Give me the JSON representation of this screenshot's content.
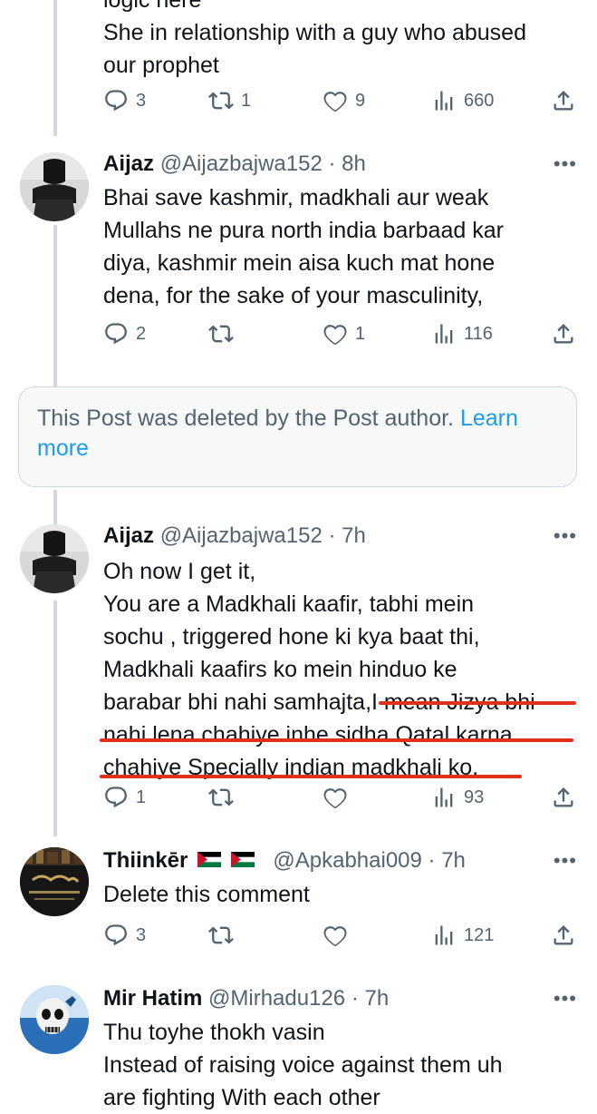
{
  "top_reply": {
    "partial_line": "logic here",
    "line1": "She in relationship with a guy who abused",
    "line2": "our prophet",
    "replies": "3",
    "reposts": "1",
    "likes": "9",
    "views": "660"
  },
  "tweet1": {
    "name": "Aijaz",
    "handle": "@Aijazbajwa152 · 8h",
    "lines": [
      "Bhai save kashmir, madkhali aur weak",
      "Mullahs ne pura north india barbaad kar",
      "diya, kashmir mein aisa kuch mat hone",
      "dena, for the sake of your masculinity,"
    ],
    "replies": "2",
    "reposts": "",
    "likes": "1",
    "views": "116"
  },
  "deleted_notice": {
    "text": "This Post was deleted by the Post author.",
    "link": "Learn more"
  },
  "tweet2": {
    "name": "Aijaz",
    "handle": "@Aijazbajwa152 · 7h",
    "lines": [
      "Oh now I get it,",
      "You are a Madkhali kaafir, tabhi mein",
      "sochu , triggered hone ki kya baat thi,",
      "Madkhali kaafirs ko mein hinduo ke",
      "barabar bhi nahi samhajta,I mean Jizya bhi",
      "nahi lena chahiye inhe sidha Qatal karna",
      "chahiye Specially indian madkhali ko."
    ],
    "replies": "1",
    "reposts": "",
    "likes": "",
    "views": "93",
    "highlight_color": "#e0301e"
  },
  "tweet3": {
    "name": "Thiinkēr",
    "handle": "@Apkabhai009 · 7h",
    "flag_icon": "palestine-flag-icon",
    "lines": [
      "Delete this comment"
    ],
    "replies": "3",
    "reposts": "",
    "likes": "",
    "views": "121"
  },
  "tweet4": {
    "name": "Mir Hatim",
    "handle": "@Mirhadu126 · 7h",
    "lines": [
      "Thu toyhe thokh vasin",
      "Instead of raising voice against them uh",
      "are fighting With each other"
    ]
  },
  "colors": {
    "text": "#0f1419",
    "muted": "#536471",
    "link": "#1d9bf0",
    "border": "#cfd9de"
  }
}
